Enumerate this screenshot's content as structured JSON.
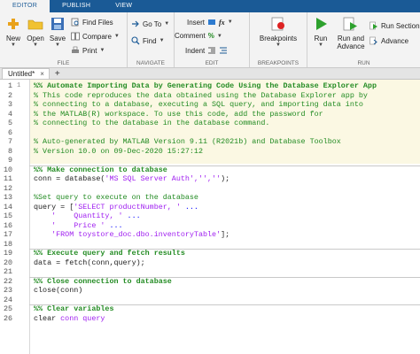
{
  "tabs": [
    "EDITOR",
    "PUBLISH",
    "VIEW"
  ],
  "file_section": {
    "label": "FILE",
    "new": "New",
    "open": "Open",
    "save": "Save",
    "find_files": "Find Files",
    "compare": "Compare",
    "print": "Print"
  },
  "navigate_section": {
    "label": "NAVIGATE",
    "goto": "Go To",
    "find": "Find"
  },
  "edit_section": {
    "label": "EDIT",
    "insert": "Insert",
    "fx": "fx",
    "comment": "Comment",
    "indent": "Indent",
    "comment_percent": "%"
  },
  "breakpoints_section": {
    "label": "BREAKPOINTS",
    "breakpoints": "Breakpoints"
  },
  "run_section": {
    "label": "RUN",
    "run": "Run",
    "run_and_advance": "Run and Advance",
    "run_section": "Run Section",
    "advance": "Advance"
  },
  "document_tab": {
    "title": "Untitled*",
    "close": "×",
    "add": "+"
  },
  "code_lines": [
    {
      "n": "1",
      "mark": "1",
      "t": "%% Automate Importing Data by Generating Code Using the Database Explorer App",
      "c": "cmtb"
    },
    {
      "n": "2",
      "t": "% This code reproduces the data obtained using the Database Explorer app by",
      "c": "cmt"
    },
    {
      "n": "3",
      "t": "% connecting to a database, executing a SQL query, and importing data into",
      "c": "cmt"
    },
    {
      "n": "4",
      "t": "% the MATLAB(R) workspace. To use this code, add the password for",
      "c": "cmt"
    },
    {
      "n": "5",
      "t": "% connecting to the database in the database command.",
      "c": "cmt"
    },
    {
      "n": "6",
      "t": "",
      "c": ""
    },
    {
      "n": "7",
      "t": "% Auto-generated by MATLAB Version 9.11 (R2021b) and Database Toolbox",
      "c": "cmt"
    },
    {
      "n": "8",
      "t": "% Version 10.0 on 09-Dec-2020 15:27:12",
      "c": "cmt"
    },
    {
      "n": "9",
      "t": "",
      "c": ""
    },
    {
      "n": "10",
      "t": "%% Make connection to database",
      "c": "cmtb"
    },
    {
      "n": "11",
      "t": "conn = database(",
      "s": "'MS SQL Server Auth','',''",
      "e": ");",
      "c": "code"
    },
    {
      "n": "12",
      "t": "",
      "c": ""
    },
    {
      "n": "13",
      "t": "%Set query to execute on the database",
      "c": "cmt"
    },
    {
      "n": "14",
      "t": "query = [",
      "s": "'SELECT productNumber, '",
      "e": " ...",
      "c": "code"
    },
    {
      "n": "15",
      "t": "    ",
      "s": "'    Quantity, '",
      "e": " ...",
      "c": "code"
    },
    {
      "n": "16",
      "t": "    ",
      "s": "'    Price '",
      "e": " ...",
      "c": "code"
    },
    {
      "n": "17",
      "t": "    ",
      "s": "'FROM toystore_doc.dbo.inventoryTable'",
      "e": "];",
      "c": "code"
    },
    {
      "n": "18",
      "t": "",
      "c": ""
    },
    {
      "n": "19",
      "t": "%% Execute query and fetch results",
      "c": "cmtb"
    },
    {
      "n": "20",
      "t": "data = fetch(conn,query);",
      "c": "code"
    },
    {
      "n": "21",
      "t": "",
      "c": ""
    },
    {
      "n": "22",
      "t": "%% Close connection to database",
      "c": "cmtb"
    },
    {
      "n": "23",
      "t": "close(conn)",
      "c": "code"
    },
    {
      "n": "24",
      "t": "",
      "c": ""
    },
    {
      "n": "25",
      "t": "%% Clear variables",
      "c": "cmtb"
    },
    {
      "n": "26",
      "t": "clear ",
      "s": "conn query",
      "e": "",
      "c": "code"
    }
  ],
  "colors": {
    "tab_bar": "#1a5a96",
    "toolstrip": "#f3f3f3",
    "comment": "#228b22",
    "string": "#a020f0",
    "cell_highlight": "#fbf8e3"
  }
}
